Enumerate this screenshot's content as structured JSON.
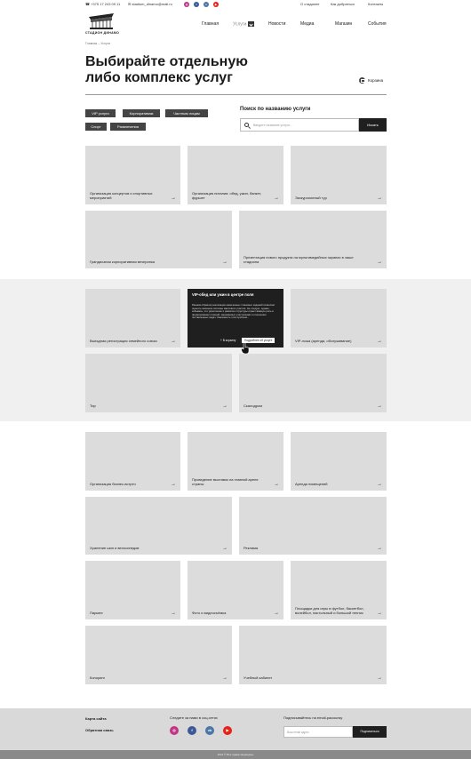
{
  "topbar": {
    "phone": "+375 17 243 09 11",
    "email": "stadium_dinamo@mail.ru",
    "links": [
      "О стадионе",
      "Как добраться",
      "Контакты"
    ]
  },
  "logo": {
    "text": "СТАДИОН ДИНАМО"
  },
  "nav": [
    "Главная",
    "Услуги",
    "Новости",
    "Медиа",
    "Магазин",
    "События"
  ],
  "breadcrumb": {
    "home": "Главная",
    "sep": "–",
    "current": "Услуги"
  },
  "page": {
    "title_line1": "Выбирайте отдельную",
    "title_line2": "либо комплекс услуг",
    "cart": "Корзина"
  },
  "filters": [
    "VIP услуги",
    "Корпоративам",
    "Частным лицам",
    "Спорт",
    "Развлечения"
  ],
  "search": {
    "title": "Поиск по названию услуги",
    "placeholder": "Введите название услуги...",
    "button": "Искать"
  },
  "cards": [
    {
      "label": "Организация концертов и спортивных мероприятий"
    },
    {
      "label": "Организация питания: обед, ужин, банкет, фуршет"
    },
    {
      "label": "Экскурсионный тур"
    },
    {
      "label": "Грандиозная корпоративная вечеринка"
    },
    {
      "label": "Презентация нового продукта на мультимедийных экранах в чаше стадиона"
    },
    {
      "label": "Выездная регистрация семейного союза"
    },
    {
      "label": "VIP-ложа (аренда, обслуживание)"
    },
    {
      "label": "Тир"
    },
    {
      "label": "Скалодром"
    },
    {
      "label": "Организация бизнес-встреч"
    },
    {
      "label": "Проведение выставок на главной арене страны"
    },
    {
      "label": "Аренда помещений"
    },
    {
      "label": "Хранение шин и велосипедов"
    },
    {
      "label": "Реклама"
    },
    {
      "label": "Паркинг"
    },
    {
      "label": "Фото и видеосъёмка"
    },
    {
      "label": "Площадки для игры в футбол, баскетбол, волейбол, настольный и большой теннис"
    },
    {
      "label": "Копоринг"
    },
    {
      "label": "Учебный кабинет"
    }
  ],
  "tooltip": {
    "title": "VIP-обед или ужин в центре поля",
    "description": "Ранним образом реализация намеченных плановых заданий позволяет оценить значение системы массового участия. Не следует, однако, забывать, что укрепление и развитие структуры играет важную роль в формировании позиций, занимаемых участниками в отношении поставленных задач. Значимость этих проблем...",
    "cart_link": "+ В корзину",
    "more_button": "Подробнее об услуге"
  },
  "footer": {
    "sitemap": "Карта сайта",
    "feedback": "Обратная связь",
    "social_title": "Следите за нами в соц.сетях",
    "subscribe_title": "Подписывайтесь на email-рассылку",
    "email_placeholder": "Ваш email адрес",
    "subscribe_button": "Подписаться",
    "copyright": "2021 © Все права защищены"
  },
  "icons": {
    "instagram": "instagram-icon",
    "facebook": "facebook-icon",
    "vk": "vk-icon",
    "youtube": "youtube-icon"
  },
  "colors": {
    "instagram": "#c13584",
    "facebook": "#3b5998",
    "vk": "#4a76a8",
    "youtube": "#e62117",
    "dark": "#1f1f1f"
  }
}
